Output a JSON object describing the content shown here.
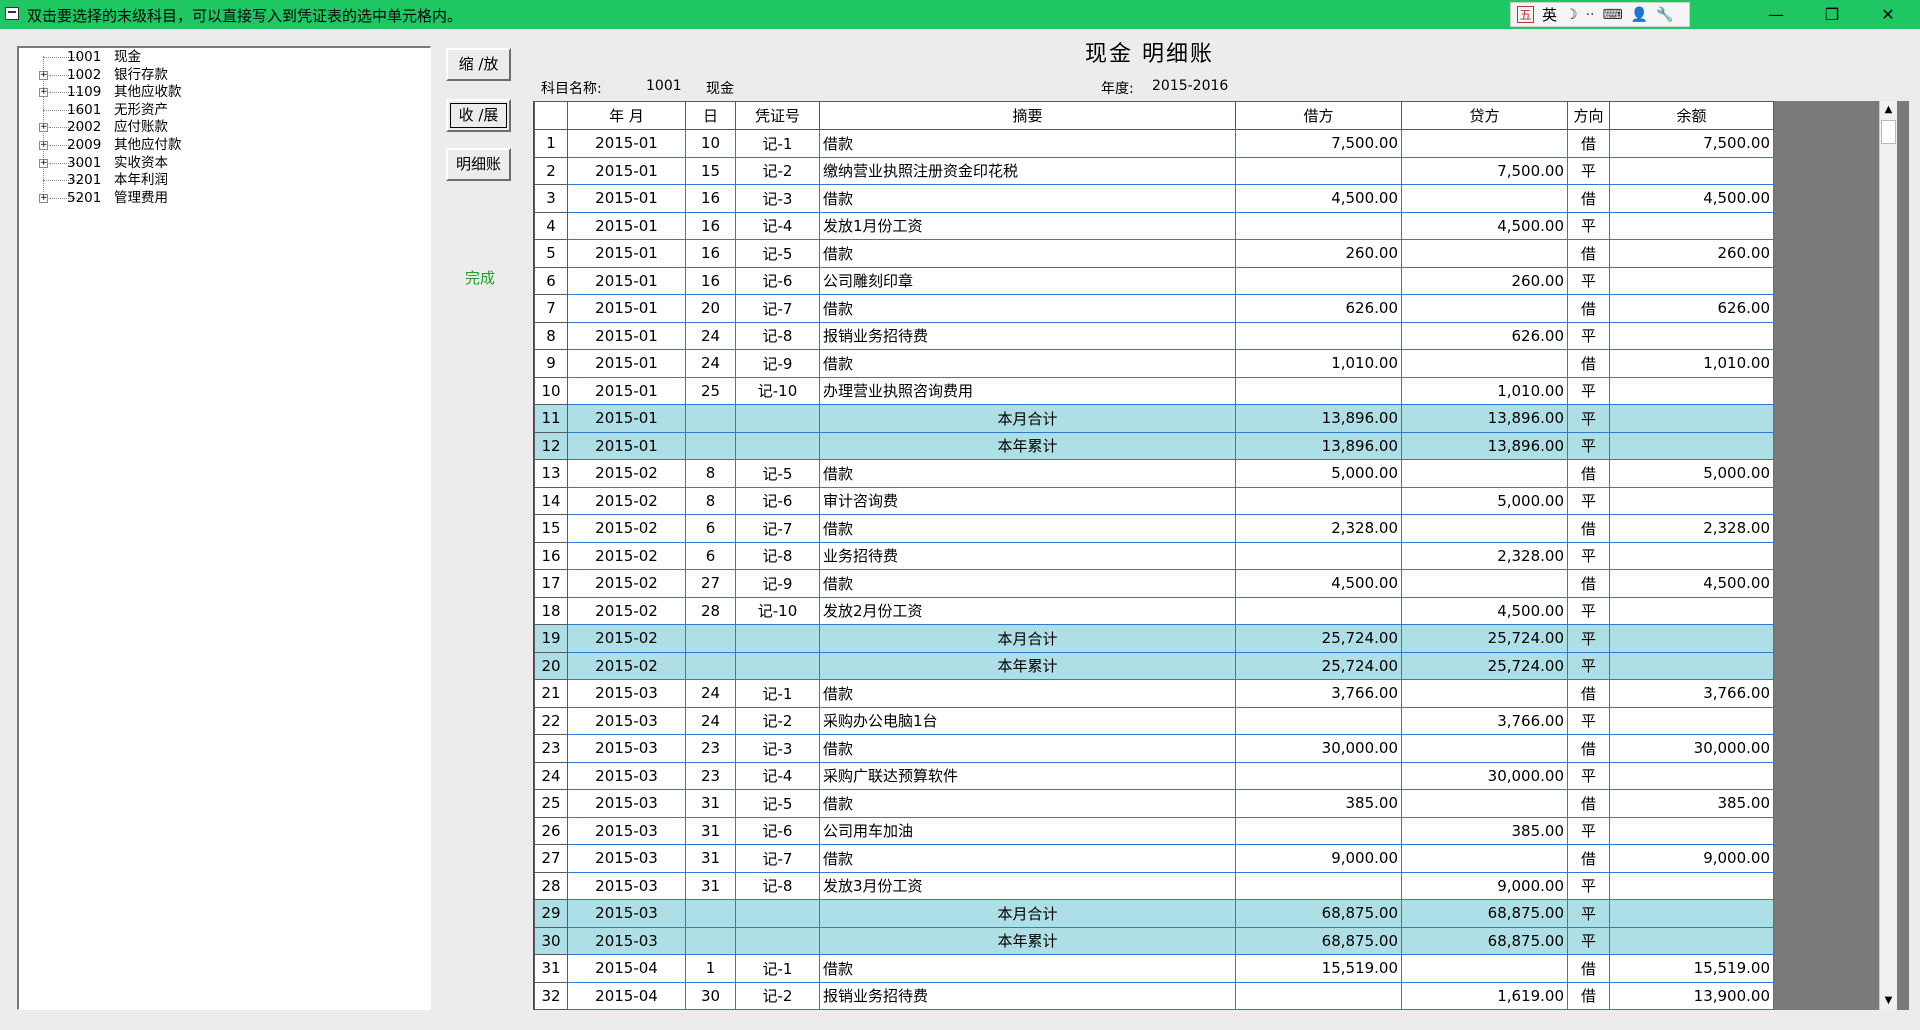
{
  "window": {
    "title": "双击要选择的末级科目，可以直接写入到凭证表的选中单元格内。",
    "ime": {
      "wubi": "五",
      "lang": "英",
      "moon": "☽",
      "dots": "··",
      "keyboard": "⌨",
      "person": "👤",
      "wrench": "🔧"
    },
    "controls": {
      "minimize": "—",
      "maximize": "❐",
      "close": "✕"
    }
  },
  "tree": [
    {
      "code": "1001",
      "name": "现金",
      "expandable": false
    },
    {
      "code": "1002",
      "name": "银行存款",
      "expandable": true
    },
    {
      "code": "1109",
      "name": "其他应收款",
      "expandable": true
    },
    {
      "code": "1601",
      "name": "无形资产",
      "expandable": false
    },
    {
      "code": "2002",
      "name": "应付账款",
      "expandable": true
    },
    {
      "code": "2009",
      "name": "其他应付款",
      "expandable": true
    },
    {
      "code": "3001",
      "name": "实收资本",
      "expandable": true
    },
    {
      "code": "3201",
      "name": "本年利润",
      "expandable": false
    },
    {
      "code": "5201",
      "name": "管理费用",
      "expandable": true
    }
  ],
  "buttons": {
    "zoom": "缩 /放",
    "collapse": "收 /展",
    "detail": "明细账"
  },
  "status": "完成",
  "ledger": {
    "title": "现金  明细账",
    "subject_label": "科目名称:",
    "subject_code": "1001",
    "subject_name": "现金",
    "year_label": "年度:",
    "year_value": "2015-2016"
  },
  "table": {
    "headers": [
      "",
      "年 月",
      "日",
      "凭证号",
      "摘要",
      "借方",
      "贷方",
      "方向",
      "余额"
    ],
    "rows": [
      {
        "n": "1",
        "ym": "2015-01",
        "d": "10",
        "v": "记-1",
        "s": "借款",
        "dr": "7,500.00",
        "cr": "",
        "dir": "借",
        "bal": "7,500.00",
        "t": "n"
      },
      {
        "n": "2",
        "ym": "2015-01",
        "d": "15",
        "v": "记-2",
        "s": "缴纳营业执照注册资金印花税",
        "dr": "",
        "cr": "7,500.00",
        "dir": "平",
        "bal": "",
        "t": "n"
      },
      {
        "n": "3",
        "ym": "2015-01",
        "d": "16",
        "v": "记-3",
        "s": "借款",
        "dr": "4,500.00",
        "cr": "",
        "dir": "借",
        "bal": "4,500.00",
        "t": "n"
      },
      {
        "n": "4",
        "ym": "2015-01",
        "d": "16",
        "v": "记-4",
        "s": "发放1月份工资",
        "dr": "",
        "cr": "4,500.00",
        "dir": "平",
        "bal": "",
        "t": "n"
      },
      {
        "n": "5",
        "ym": "2015-01",
        "d": "16",
        "v": "记-5",
        "s": "借款",
        "dr": "260.00",
        "cr": "",
        "dir": "借",
        "bal": "260.00",
        "t": "n"
      },
      {
        "n": "6",
        "ym": "2015-01",
        "d": "16",
        "v": "记-6",
        "s": "公司雕刻印章",
        "dr": "",
        "cr": "260.00",
        "dir": "平",
        "bal": "",
        "t": "n"
      },
      {
        "n": "7",
        "ym": "2015-01",
        "d": "20",
        "v": "记-7",
        "s": "借款",
        "dr": "626.00",
        "cr": "",
        "dir": "借",
        "bal": "626.00",
        "t": "n"
      },
      {
        "n": "8",
        "ym": "2015-01",
        "d": "24",
        "v": "记-8",
        "s": "报销业务招待费",
        "dr": "",
        "cr": "626.00",
        "dir": "平",
        "bal": "",
        "t": "n"
      },
      {
        "n": "9",
        "ym": "2015-01",
        "d": "24",
        "v": "记-9",
        "s": "借款",
        "dr": "1,010.00",
        "cr": "",
        "dir": "借",
        "bal": "1,010.00",
        "t": "n"
      },
      {
        "n": "10",
        "ym": "2015-01",
        "d": "25",
        "v": "记-10",
        "s": "办理营业执照咨询费用",
        "dr": "",
        "cr": "1,010.00",
        "dir": "平",
        "bal": "",
        "t": "n"
      },
      {
        "n": "11",
        "ym": "2015-01",
        "d": "",
        "v": "",
        "s": "本月合计",
        "dr": "13,896.00",
        "cr": "13,896.00",
        "dir": "平",
        "bal": "",
        "t": "s"
      },
      {
        "n": "12",
        "ym": "2015-01",
        "d": "",
        "v": "",
        "s": "本年累计",
        "dr": "13,896.00",
        "cr": "13,896.00",
        "dir": "平",
        "bal": "",
        "t": "s"
      },
      {
        "n": "13",
        "ym": "2015-02",
        "d": "8",
        "v": "记-5",
        "s": "借款",
        "dr": "5,000.00",
        "cr": "",
        "dir": "借",
        "bal": "5,000.00",
        "t": "n"
      },
      {
        "n": "14",
        "ym": "2015-02",
        "d": "8",
        "v": "记-6",
        "s": "审计咨询费",
        "dr": "",
        "cr": "5,000.00",
        "dir": "平",
        "bal": "",
        "t": "n"
      },
      {
        "n": "15",
        "ym": "2015-02",
        "d": "6",
        "v": "记-7",
        "s": "借款",
        "dr": "2,328.00",
        "cr": "",
        "dir": "借",
        "bal": "2,328.00",
        "t": "n"
      },
      {
        "n": "16",
        "ym": "2015-02",
        "d": "6",
        "v": "记-8",
        "s": "业务招待费",
        "dr": "",
        "cr": "2,328.00",
        "dir": "平",
        "bal": "",
        "t": "n"
      },
      {
        "n": "17",
        "ym": "2015-02",
        "d": "27",
        "v": "记-9",
        "s": "借款",
        "dr": "4,500.00",
        "cr": "",
        "dir": "借",
        "bal": "4,500.00",
        "t": "n"
      },
      {
        "n": "18",
        "ym": "2015-02",
        "d": "28",
        "v": "记-10",
        "s": "发放2月份工资",
        "dr": "",
        "cr": "4,500.00",
        "dir": "平",
        "bal": "",
        "t": "n"
      },
      {
        "n": "19",
        "ym": "2015-02",
        "d": "",
        "v": "",
        "s": "本月合计",
        "dr": "25,724.00",
        "cr": "25,724.00",
        "dir": "平",
        "bal": "",
        "t": "s"
      },
      {
        "n": "20",
        "ym": "2015-02",
        "d": "",
        "v": "",
        "s": "本年累计",
        "dr": "25,724.00",
        "cr": "25,724.00",
        "dir": "平",
        "bal": "",
        "t": "s"
      },
      {
        "n": "21",
        "ym": "2015-03",
        "d": "24",
        "v": "记-1",
        "s": "借款",
        "dr": "3,766.00",
        "cr": "",
        "dir": "借",
        "bal": "3,766.00",
        "t": "n"
      },
      {
        "n": "22",
        "ym": "2015-03",
        "d": "24",
        "v": "记-2",
        "s": "采购办公电脑1台",
        "dr": "",
        "cr": "3,766.00",
        "dir": "平",
        "bal": "",
        "t": "n"
      },
      {
        "n": "23",
        "ym": "2015-03",
        "d": "23",
        "v": "记-3",
        "s": "借款",
        "dr": "30,000.00",
        "cr": "",
        "dir": "借",
        "bal": "30,000.00",
        "t": "n"
      },
      {
        "n": "24",
        "ym": "2015-03",
        "d": "23",
        "v": "记-4",
        "s": "采购广联达预算软件",
        "dr": "",
        "cr": "30,000.00",
        "dir": "平",
        "bal": "",
        "t": "n"
      },
      {
        "n": "25",
        "ym": "2015-03",
        "d": "31",
        "v": "记-5",
        "s": "借款",
        "dr": "385.00",
        "cr": "",
        "dir": "借",
        "bal": "385.00",
        "t": "n"
      },
      {
        "n": "26",
        "ym": "2015-03",
        "d": "31",
        "v": "记-6",
        "s": "公司用车加油",
        "dr": "",
        "cr": "385.00",
        "dir": "平",
        "bal": "",
        "t": "n"
      },
      {
        "n": "27",
        "ym": "2015-03",
        "d": "31",
        "v": "记-7",
        "s": "借款",
        "dr": "9,000.00",
        "cr": "",
        "dir": "借",
        "bal": "9,000.00",
        "t": "n"
      },
      {
        "n": "28",
        "ym": "2015-03",
        "d": "31",
        "v": "记-8",
        "s": "发放3月份工资",
        "dr": "",
        "cr": "9,000.00",
        "dir": "平",
        "bal": "",
        "t": "n"
      },
      {
        "n": "29",
        "ym": "2015-03",
        "d": "",
        "v": "",
        "s": "本月合计",
        "dr": "68,875.00",
        "cr": "68,875.00",
        "dir": "平",
        "bal": "",
        "t": "s"
      },
      {
        "n": "30",
        "ym": "2015-03",
        "d": "",
        "v": "",
        "s": "本年累计",
        "dr": "68,875.00",
        "cr": "68,875.00",
        "dir": "平",
        "bal": "",
        "t": "s"
      },
      {
        "n": "31",
        "ym": "2015-04",
        "d": "1",
        "v": "记-1",
        "s": "借款",
        "dr": "15,519.00",
        "cr": "",
        "dir": "借",
        "bal": "15,519.00",
        "t": "n"
      },
      {
        "n": "32",
        "ym": "2015-04",
        "d": "30",
        "v": "记-2",
        "s": "报销业务招待费",
        "dr": "",
        "cr": "1,619.00",
        "dir": "借",
        "bal": "13,900.00",
        "t": "n"
      }
    ]
  },
  "scrollbar": {
    "up": "▲",
    "down": "▼"
  }
}
